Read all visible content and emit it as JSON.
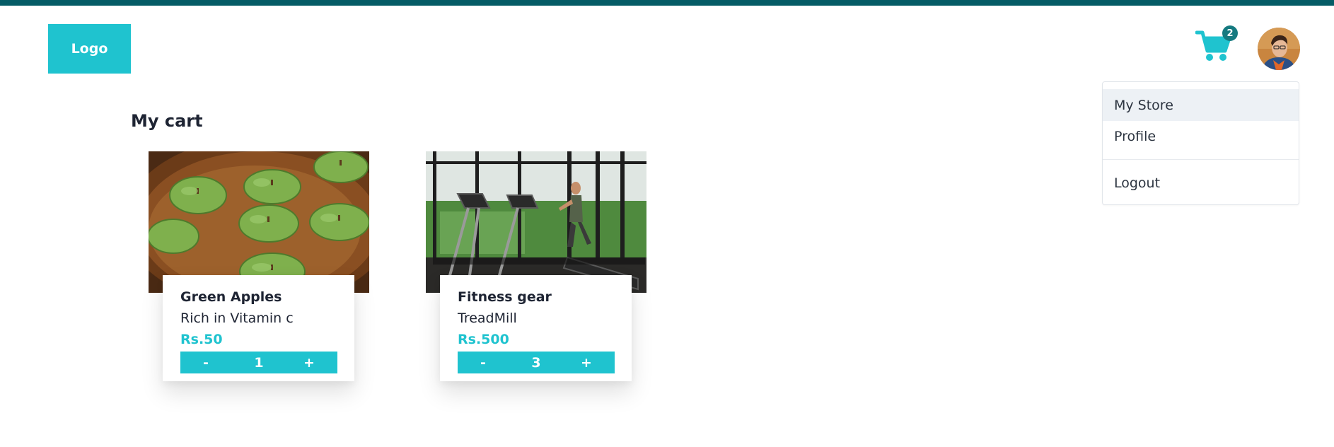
{
  "header": {
    "logo_label": "Logo",
    "cart_count": "2",
    "accent_color": "#1fc3cf",
    "topbar_color": "#055c66"
  },
  "user_menu": {
    "items": [
      {
        "label": "My Store",
        "active": true
      },
      {
        "label": "Profile",
        "active": false
      },
      {
        "label": "Logout",
        "active": false
      }
    ]
  },
  "main": {
    "title": "My cart"
  },
  "cart": {
    "items": [
      {
        "name": "Green Apples",
        "description": "Rich in Vitamin c",
        "price": "Rs.50",
        "quantity": "1",
        "minus_label": "-",
        "plus_label": "+"
      },
      {
        "name": "Fitness gear",
        "description": "TreadMill",
        "price": "Rs.500",
        "quantity": "3",
        "minus_label": "-",
        "plus_label": "+"
      }
    ]
  }
}
